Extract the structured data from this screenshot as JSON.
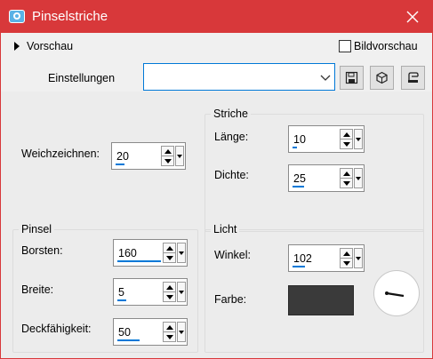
{
  "window": {
    "title": "Pinselstriche"
  },
  "preview": {
    "label": "Vorschau",
    "image_preview_label": "Bildvorschau"
  },
  "settings": {
    "label": "Einstellungen",
    "value": ""
  },
  "main": {
    "soften_label": "Weichzeichnen:",
    "soften_value": "20",
    "soften_fraction": 0.2
  },
  "strokes": {
    "title": "Striche",
    "length_label": "Länge:",
    "length_value": "10",
    "length_fraction": 0.1,
    "density_label": "Dichte:",
    "density_value": "25",
    "density_fraction": 0.25
  },
  "brush": {
    "title": "Pinsel",
    "bristles_label": "Borsten:",
    "bristles_value": "160",
    "bristles_fraction": 1.0,
    "width_label": "Breite:",
    "width_value": "5",
    "width_fraction": 0.2,
    "opacity_label": "Deckfähigkeit:",
    "opacity_value": "50",
    "opacity_fraction": 0.5
  },
  "light": {
    "title": "Licht",
    "angle_label": "Winkel:",
    "angle_value": "102",
    "angle_fraction": 0.28,
    "color_label": "Farbe:",
    "color_value": "#3a3a3a"
  },
  "icons": {
    "app": "camera-icon",
    "close": "close-icon",
    "save": "save-icon",
    "load": "cube-icon",
    "delete": "delete-preset-icon"
  },
  "colors": {
    "titlebar": "#d8383a",
    "accent": "#0078d7"
  }
}
